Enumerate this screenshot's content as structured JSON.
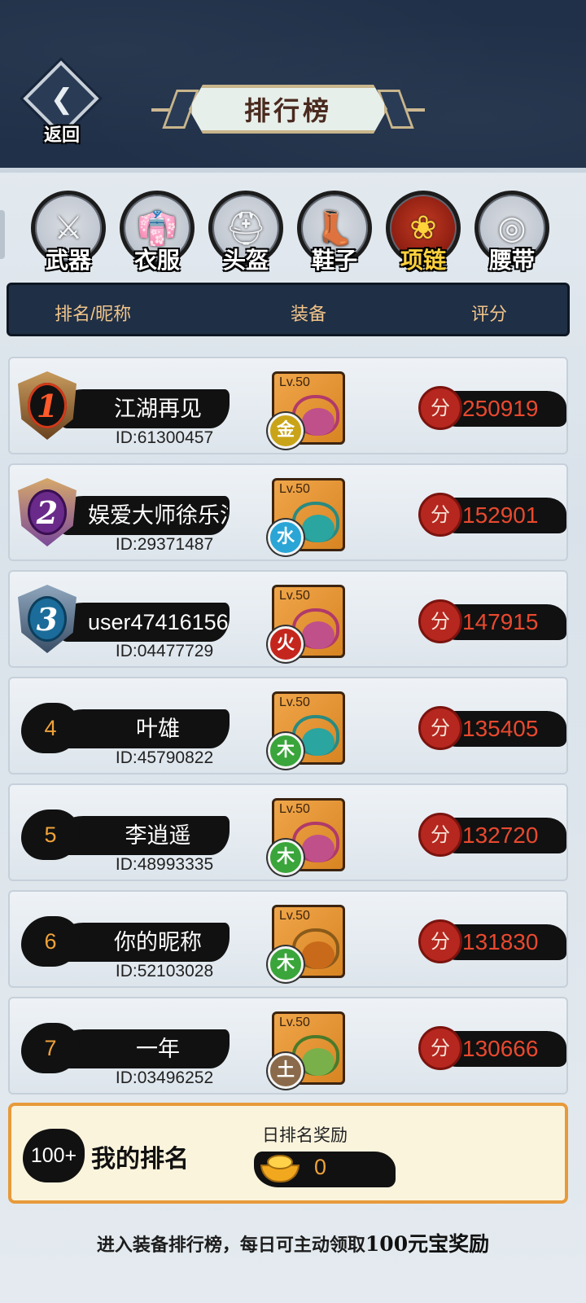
{
  "header": {
    "back_label": "返回",
    "title": "排行榜"
  },
  "tabs": [
    {
      "label": "武器",
      "icon": "sword-icon",
      "glyph": "⚔",
      "active": false
    },
    {
      "label": "衣服",
      "icon": "armor-icon",
      "glyph": "👘",
      "active": false
    },
    {
      "label": "头盔",
      "icon": "helmet-icon",
      "glyph": "⛑",
      "active": false
    },
    {
      "label": "鞋子",
      "icon": "boot-icon",
      "glyph": "👢",
      "active": false
    },
    {
      "label": "项链",
      "icon": "necklace-icon",
      "glyph": "❀",
      "active": true
    },
    {
      "label": "腰带",
      "icon": "belt-icon",
      "glyph": "◎",
      "active": false
    }
  ],
  "columns": {
    "rank_name": "排名/昵称",
    "equip": "装备",
    "score": "评分"
  },
  "rows": [
    {
      "rank": "1",
      "name": "江湖再见",
      "id": "ID:61300457",
      "level": "Lv.50",
      "element": "金",
      "score": "250919",
      "score_coin": "分"
    },
    {
      "rank": "2",
      "name": "娱爱大师徐乐泫",
      "id": "ID:29371487",
      "level": "Lv.50",
      "element": "水",
      "score": "152901",
      "score_coin": "分"
    },
    {
      "rank": "3",
      "name": "user47416156",
      "id": "ID:04477729",
      "level": "Lv.50",
      "element": "火",
      "score": "147915",
      "score_coin": "分"
    },
    {
      "rank": "4",
      "name": "叶雄",
      "id": "ID:45790822",
      "level": "Lv.50",
      "element": "木",
      "score": "135405",
      "score_coin": "分"
    },
    {
      "rank": "5",
      "name": "李逍遥",
      "id": "ID:48993335",
      "level": "Lv.50",
      "element": "木",
      "score": "132720",
      "score_coin": "分"
    },
    {
      "rank": "6",
      "name": "你的昵称",
      "id": "ID:52103028",
      "level": "Lv.50",
      "element": "木",
      "score": "131830",
      "score_coin": "分"
    },
    {
      "rank": "7",
      "name": "一年",
      "id": "ID:03496252",
      "level": "Lv.50",
      "element": "土",
      "score": "130666",
      "score_coin": "分"
    }
  ],
  "my_rank": {
    "rank": "100+",
    "label": "我的排名",
    "daily_label": "日排名奖励",
    "reward_value": "0"
  },
  "footer": {
    "prefix": "进入装备排行榜，每日可主动领取",
    "highlight": "100元宝奖励"
  },
  "colors": {
    "header_bg": "#1f3048",
    "active_tab": "#8f1f12",
    "score_text": "#e8492f",
    "rank_orange": "#f0a23a",
    "panel_border": "#e79a3a",
    "element_metal": "#c9a418",
    "element_water": "#2aa5d6",
    "element_fire": "#c4261d",
    "element_wood": "#3aa53a",
    "element_earth": "#8a6a4a"
  }
}
